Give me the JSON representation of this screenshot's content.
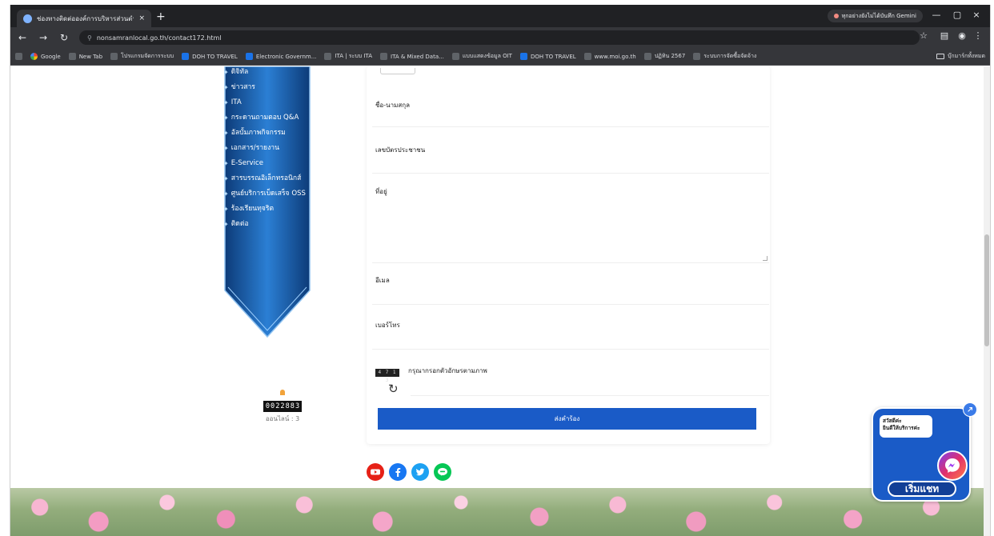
{
  "browser": {
    "tab_title": "ช่องทางติดต่อองค์การบริหารส่วนตำบล",
    "tab_close": "×",
    "new_tab": "+",
    "profile_label": "ทุกอย่างยังไม่ได้บันทึก Gemini",
    "url": "nonsamranlocal.go.th/contact172.html",
    "window_controls": [
      "—",
      "▢",
      "×"
    ]
  },
  "bookmarks": {
    "items": [
      {
        "label": "Google",
        "icon": "google"
      },
      {
        "label": "New Tab",
        "icon": "default"
      },
      {
        "label": "โปรแกรมจัดการระบบ",
        "icon": "default"
      },
      {
        "label": "DOH TO TRAVEL",
        "icon": "blue"
      },
      {
        "label": "Electronic Governm...",
        "icon": "blue"
      },
      {
        "label": "ITA | ระบบ ITA",
        "icon": "default"
      },
      {
        "label": "ITA & Mixed Data...",
        "icon": "default"
      },
      {
        "label": "แบบแสดงข้อมูล OIT",
        "icon": "default"
      },
      {
        "label": "DOH TO TRAVEL",
        "icon": "blue"
      },
      {
        "label": "www.moi.go.th",
        "icon": "default"
      },
      {
        "label": "ปฏิทิน 2567",
        "icon": "default"
      },
      {
        "label": "ระบบการจัดซื้อจัดจ้าง",
        "icon": "default"
      }
    ],
    "all_bookmarks": "บุ๊กมาร์กทั้งหมด"
  },
  "sidebar": {
    "items": [
      "ดิจิทัล",
      "ข่าวสาร",
      "ITA",
      "กระดานถามตอบ Q&A",
      "อัลบั้มภาพกิจกรรม",
      "เอกสาร/รายงาน",
      "E-Service",
      "สารบรรณอิเล็กทรอนิกส์",
      "ศูนย์บริการเบ็ดเสร็จ OSS",
      "ร้องเรียนทุจริต",
      "ติดต่อ"
    ]
  },
  "counter": {
    "digits": [
      "0",
      "0",
      "2",
      "2",
      "8",
      "8",
      "3"
    ],
    "online": "ออนไลน์ : 3"
  },
  "form": {
    "name_label": "ชื่อ-นามสกุล",
    "id_label": "เลขบัตรประชาชน",
    "address_label": "ที่อยู่",
    "email_label": "อีเมล",
    "phone_label": "เบอร์โทร",
    "captcha_text": "4 7 1 3",
    "captcha_label": "กรุณากรอกตัวอักษรตามภาพ",
    "submit_label": "ส่งคำร้อง"
  },
  "social": {
    "icons": [
      "youtube-icon",
      "facebook-icon",
      "twitter-icon",
      "line-icon"
    ],
    "colors": {
      "youtube": "#e62117",
      "facebook": "#1877f2",
      "twitter": "#1da1f2",
      "line": "#06c755"
    }
  },
  "chat": {
    "bubble_line1": "สวัสดีค่ะ",
    "bubble_line2": "ยินดีให้บริการค่ะ",
    "start_label": "เริ่มแชท",
    "close": "×"
  },
  "colors": {
    "primary": "#1a5bc7",
    "sidebar_dark": "#0d3b78",
    "sidebar_light": "#2b7fd4"
  }
}
